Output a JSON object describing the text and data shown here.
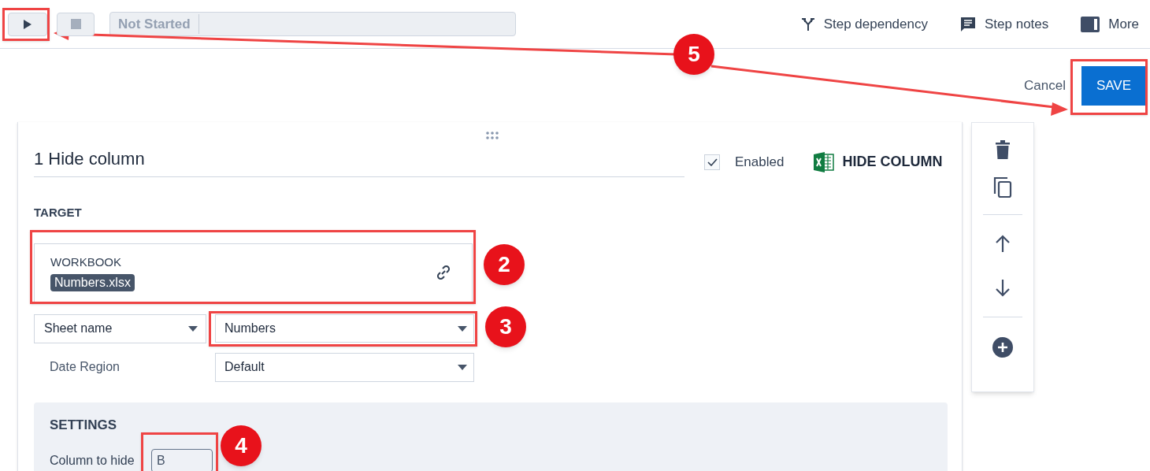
{
  "toolbar": {
    "status": "Not Started",
    "actions": [
      {
        "kind": "dependency",
        "label": "Step dependency"
      },
      {
        "kind": "notes",
        "label": "Step notes"
      },
      {
        "kind": "more",
        "label": "More"
      }
    ]
  },
  "form_actions": {
    "cancel": "Cancel",
    "save": "SAVE"
  },
  "step": {
    "title": "1 Hide column",
    "enabled_label": "Enabled",
    "enabled": true,
    "action_label": "HIDE COLUMN",
    "target": {
      "heading": "TARGET",
      "workbook_label": "WORKBOOK",
      "workbook_value": "Numbers.xlsx",
      "sheet_mode": "Sheet name",
      "sheet_value": "Numbers",
      "date_region_label": "Date Region",
      "date_region_value": "Default"
    },
    "settings": {
      "heading": "SETTINGS",
      "column_label": "Column to hide",
      "column_value": "B"
    }
  },
  "callouts": [
    "2",
    "3",
    "4",
    "5"
  ]
}
